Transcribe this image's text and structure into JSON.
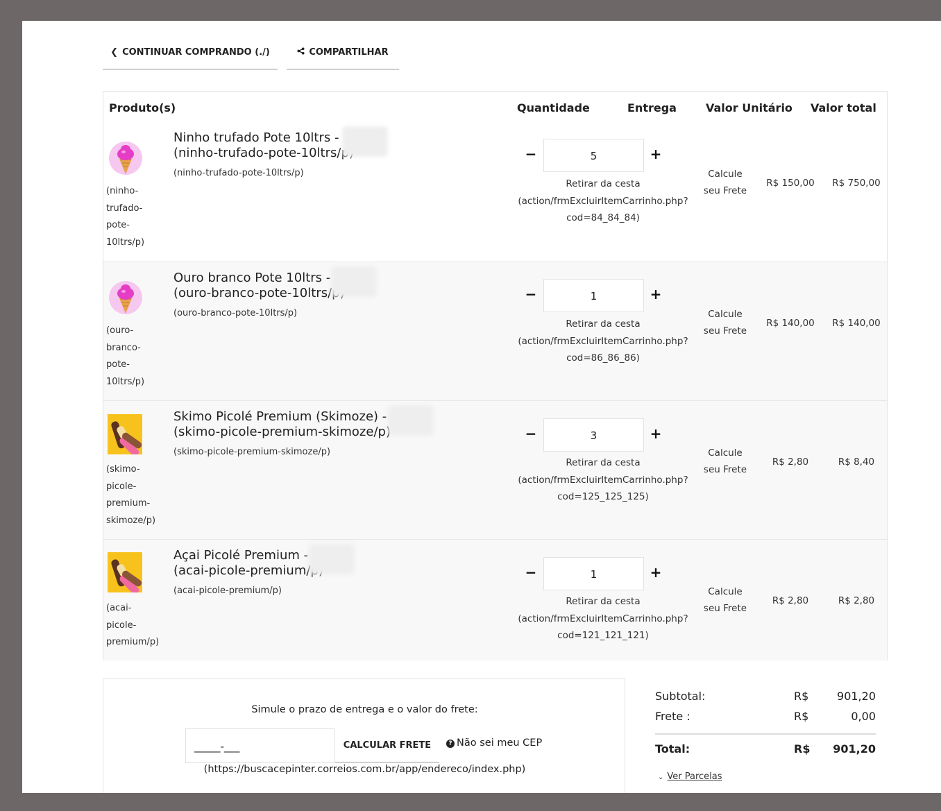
{
  "nav": {
    "continue_label": "CONTINUAR COMPRANDO (./)",
    "share_label": "COMPARTILHAR"
  },
  "table": {
    "headers": {
      "produto": "Produto(s)",
      "quantidade": "Quantidade",
      "entrega": "Entrega",
      "valor_unitario": "Valor Unitário",
      "valor_total": "Valor total"
    },
    "items": [
      {
        "image": "ice-cream-cone",
        "slug_lines": [
          "(ninho-",
          "trufado-",
          "pote-",
          "10ltrs/p)"
        ],
        "name_line1": "Ninho trufado Pote 10ltrs -",
        "name_line2": "(ninho-trufado-pote-10ltrs/p)",
        "sub": "(ninho-trufado-pote-10ltrs/p)",
        "qty": "5",
        "remove": [
          "Retirar da cesta",
          "(action/frmExcluirItemCarrinho.php?",
          "cod=84_84_84)"
        ],
        "frete": [
          "Calcule",
          "seu Frete"
        ],
        "unit": "R$ 150,00",
        "total": "R$ 750,00"
      },
      {
        "image": "ice-cream-cone",
        "slug_lines": [
          "(ouro-",
          "branco-",
          "pote-",
          "10ltrs/p)"
        ],
        "name_line1": "Ouro branco Pote 10ltrs -",
        "name_line2": "(ouro-branco-pote-10ltrs/p)",
        "sub": "(ouro-branco-pote-10ltrs/p)",
        "qty": "1",
        "remove": [
          "Retirar da cesta",
          "(action/frmExcluirItemCarrinho.php?",
          "cod=86_86_86)"
        ],
        "frete": [
          "Calcule",
          "seu Frete"
        ],
        "unit": "R$ 140,00",
        "total": "R$ 140,00"
      },
      {
        "image": "popsicles",
        "slug_lines": [
          "(skimo-",
          "picole-",
          "premium-",
          "skimoze/p)"
        ],
        "name_line1": "Skimo Picolé Premium (Skimoze) -",
        "name_line2": "(skimo-picole-premium-skimoze/p)",
        "sub": "(skimo-picole-premium-skimoze/p)",
        "qty": "3",
        "remove": [
          "Retirar da cesta",
          "(action/frmExcluirItemCarrinho.php?",
          "cod=125_125_125)"
        ],
        "frete": [
          "Calcule",
          "seu Frete"
        ],
        "unit": "R$ 2,80",
        "total": "R$ 8,40"
      },
      {
        "image": "popsicles",
        "slug_lines": [
          "(acai-",
          "picole-",
          "premium/p)"
        ],
        "name_line1": "Açai Picolé Premium -",
        "name_line2": "(acai-picole-premium/p)",
        "sub": "(acai-picole-premium/p)",
        "qty": "1",
        "remove": [
          "Retirar da cesta",
          "(action/frmExcluirItemCarrinho.php?",
          "cod=121_121_121)"
        ],
        "frete": [
          "Calcule",
          "seu Frete"
        ],
        "unit": "R$ 2,80",
        "total": "R$ 2,80"
      }
    ],
    "minus": "−",
    "plus": "+"
  },
  "shipping": {
    "title": "Simule o prazo de entrega e o valor do frete:",
    "cep_value": "_____-___",
    "calc_label": "CALCULAR FRETE",
    "help_label": "Não sei meu CEP",
    "help_url": "(https://buscacepinter.correios.com.br/app/endereco/index.php)"
  },
  "summary": {
    "subtotal_label": "Subtotal:",
    "subtotal_currency": "R$",
    "subtotal_value": "901,20",
    "frete_label": "Frete :",
    "frete_currency": "R$",
    "frete_value": "0,00",
    "total_label": "Total:",
    "total_currency": "R$",
    "total_value": "901,20",
    "parcelas_label": "Ver Parcelas"
  },
  "colors": {
    "frame": "#6e6767",
    "row_alt": "#f8f8f8",
    "border": "#e2e2e2"
  }
}
